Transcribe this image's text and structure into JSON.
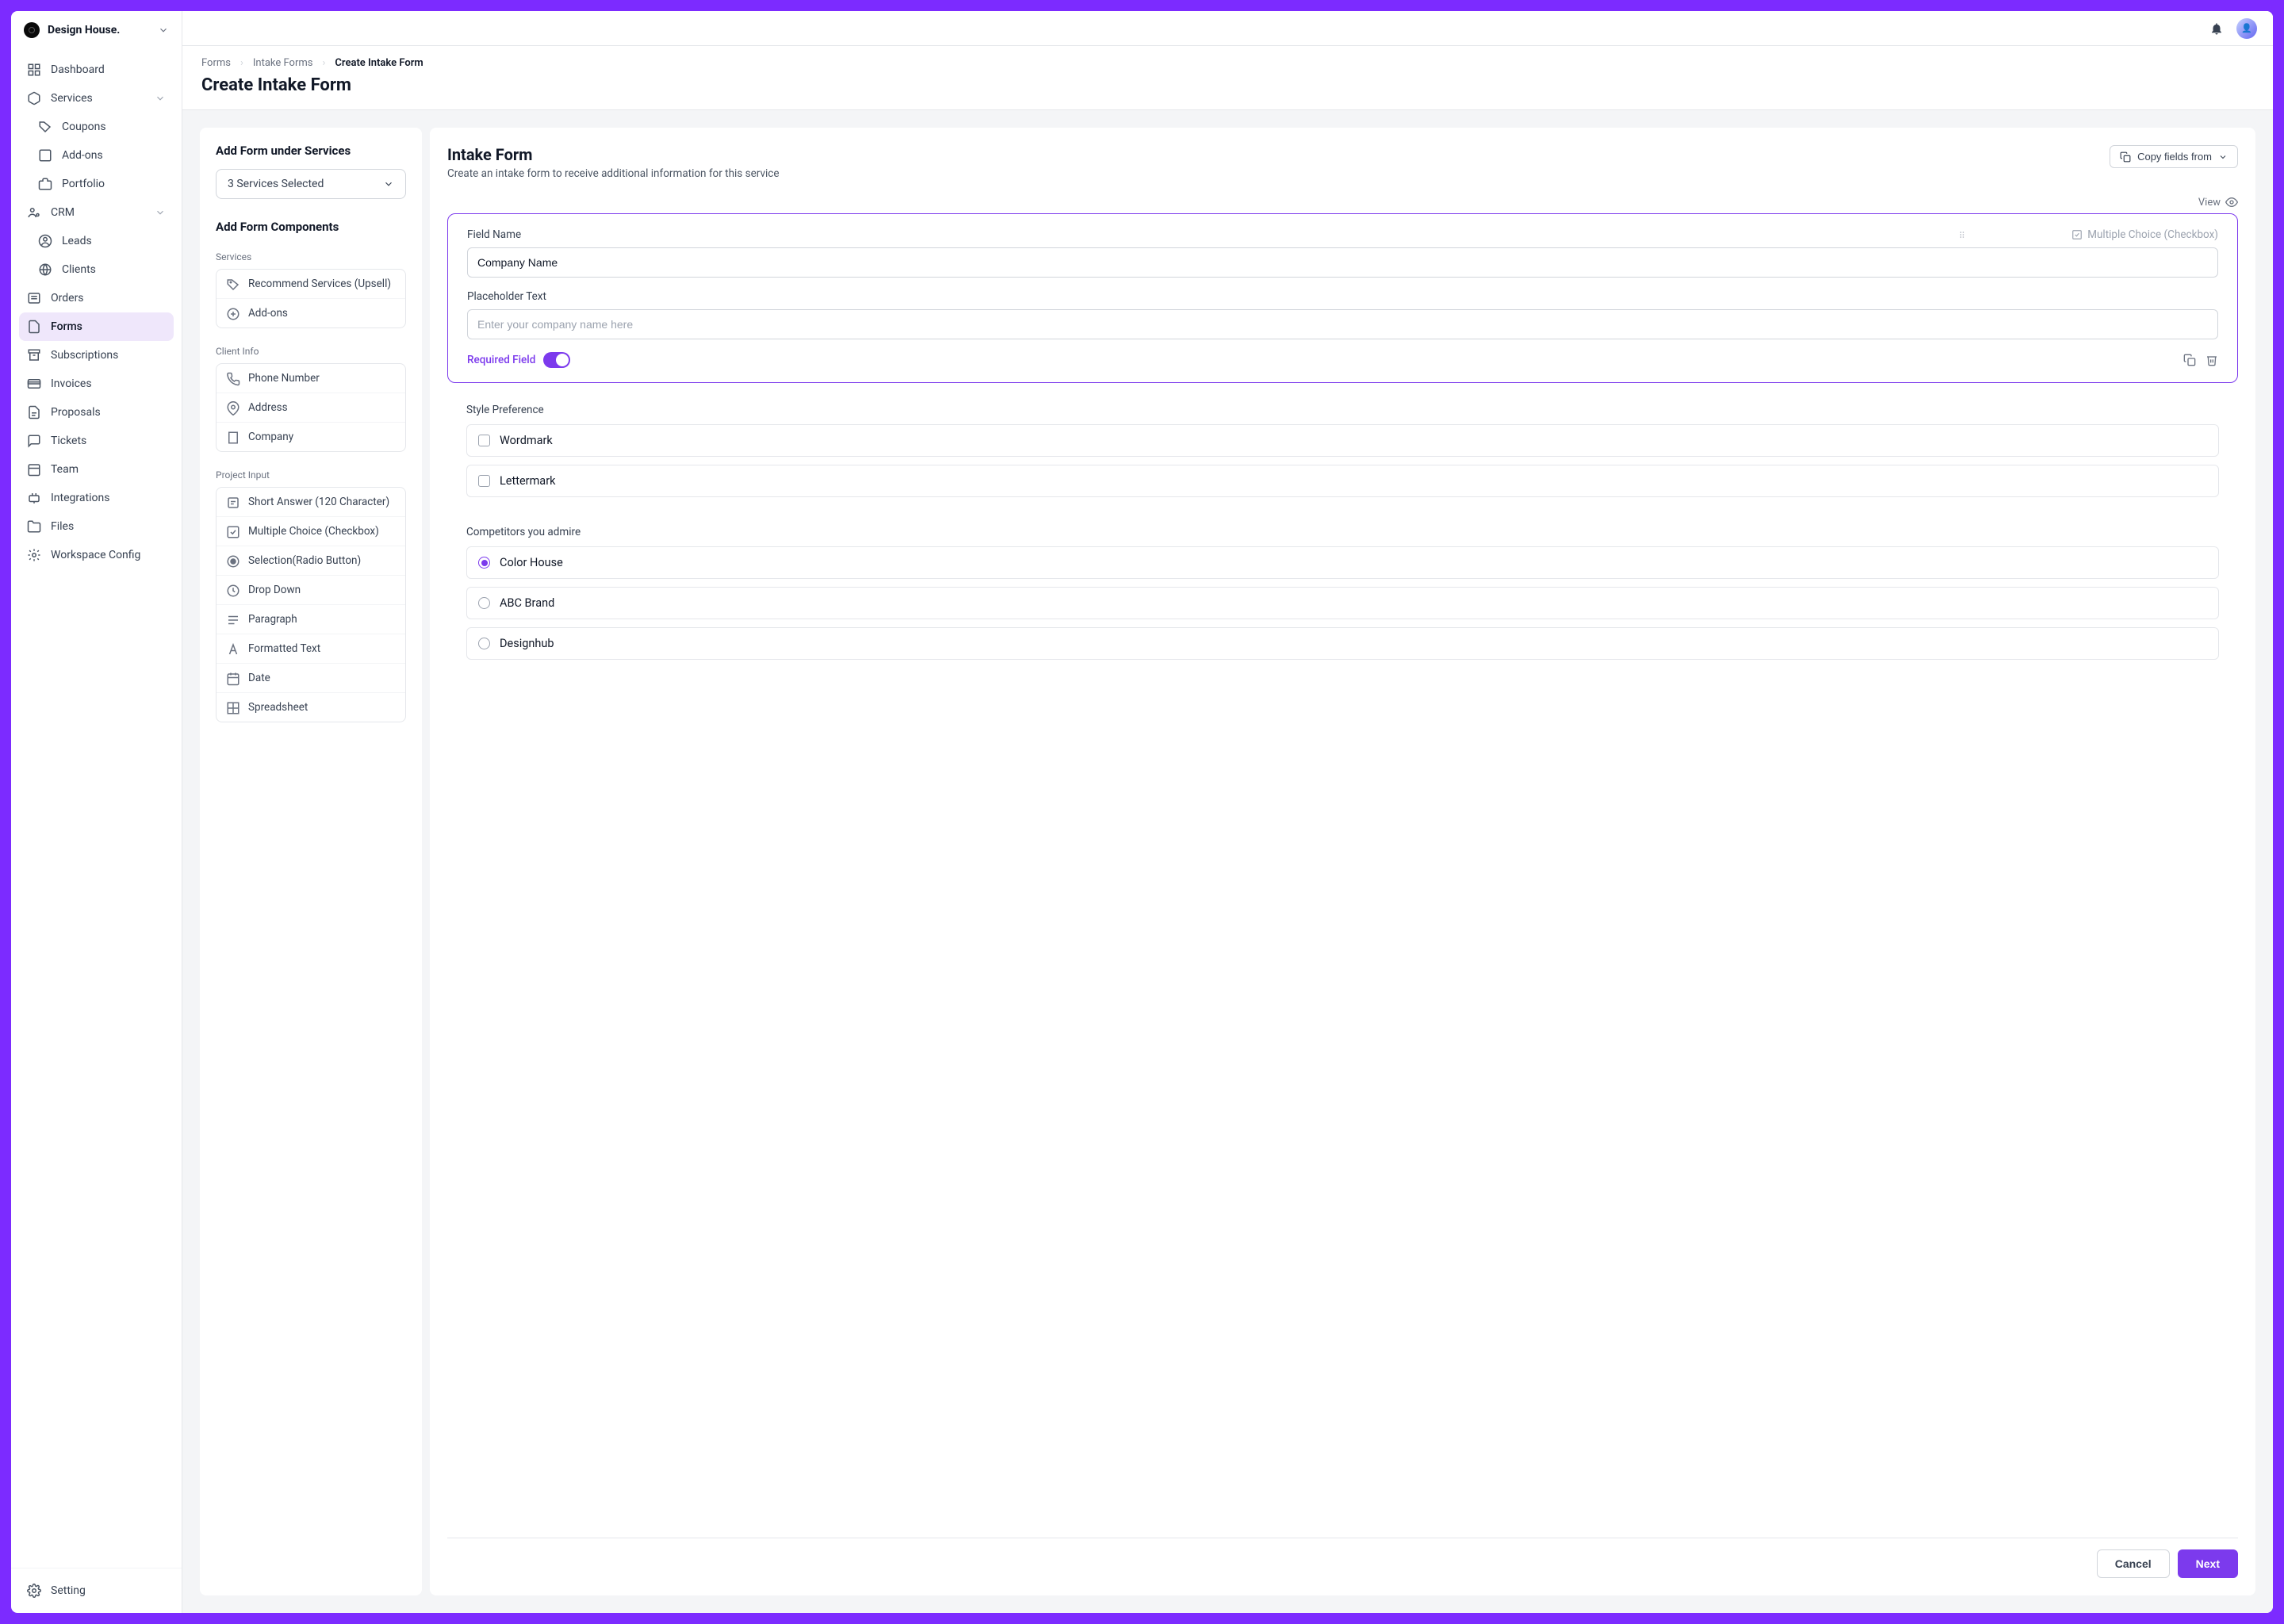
{
  "workspace": {
    "name": "Design House."
  },
  "sidebar": {
    "items": [
      {
        "label": "Dashboard",
        "icon": "dashboard-icon"
      },
      {
        "label": "Services",
        "icon": "box-icon",
        "expandable": true
      },
      {
        "label": "Coupons",
        "icon": "tag-icon",
        "sub": true
      },
      {
        "label": "Add-ons",
        "icon": "plus-square-icon",
        "sub": true
      },
      {
        "label": "Portfolio",
        "icon": "briefcase-icon",
        "sub": true
      },
      {
        "label": "CRM",
        "icon": "people-gear-icon",
        "expandable": true
      },
      {
        "label": "Leads",
        "icon": "person-circle-icon",
        "sub": true
      },
      {
        "label": "Clients",
        "icon": "globe-icon",
        "sub": true
      },
      {
        "label": "Orders",
        "icon": "list-icon"
      },
      {
        "label": "Forms",
        "icon": "file-icon",
        "active": true
      },
      {
        "label": "Subscriptions",
        "icon": "archive-icon"
      },
      {
        "label": "Invoices",
        "icon": "card-icon"
      },
      {
        "label": "Proposals",
        "icon": "document-icon"
      },
      {
        "label": "Tickets",
        "icon": "chat-icon"
      },
      {
        "label": "Team",
        "icon": "calendar-icon"
      },
      {
        "label": "Integrations",
        "icon": "plug-icon"
      },
      {
        "label": "Files",
        "icon": "folder-icon"
      },
      {
        "label": "Workspace Config",
        "icon": "gear-icon"
      }
    ],
    "footer": {
      "label": "Setting",
      "icon": "gear-icon"
    }
  },
  "breadcrumbs": [
    "Forms",
    "Intake Forms",
    "Create Intake Form"
  ],
  "page_title": "Create Intake Form",
  "left_panel": {
    "add_under_title": "Add Form under Services",
    "services_selected": "3 Services Selected",
    "add_components_title": "Add Form Components",
    "groups": [
      {
        "label": "Services",
        "items": [
          {
            "label": "Recommend Services (Upsell)",
            "icon": "tag-outline-icon"
          },
          {
            "label": "Add-ons",
            "icon": "circle-plus-icon"
          }
        ]
      },
      {
        "label": "Client Info",
        "items": [
          {
            "label": "Phone Number",
            "icon": "phone-icon"
          },
          {
            "label": "Address",
            "icon": "pin-icon"
          },
          {
            "label": "Company",
            "icon": "building-icon"
          }
        ]
      },
      {
        "label": "Project Input",
        "items": [
          {
            "label": "Short Answer (120 Character)",
            "icon": "text-line-icon"
          },
          {
            "label": "Multiple Choice (Checkbox)",
            "icon": "checkbox-icon"
          },
          {
            "label": "Selection(Radio Button)",
            "icon": "radio-icon"
          },
          {
            "label": "Drop Down",
            "icon": "clock-icon"
          },
          {
            "label": "Paragraph",
            "icon": "paragraph-icon"
          },
          {
            "label": "Formatted Text",
            "icon": "format-icon"
          },
          {
            "label": "Date",
            "icon": "date-icon"
          },
          {
            "label": "Spreadsheet",
            "icon": "grid-icon"
          }
        ]
      }
    ]
  },
  "right_panel": {
    "title": "Intake Form",
    "subtitle": "Create an intake form to receive additional information for this service",
    "copy_button": "Copy fields from",
    "view_label": "View",
    "field_card": {
      "field_name_label": "Field Name",
      "field_name_value": "Company Name",
      "type_label": "Multiple Choice (Checkbox)",
      "placeholder_label": "Placeholder Text",
      "placeholder_hint": "Enter your company name here",
      "required_label": "Required Field"
    },
    "style_pref": {
      "label": "Style Preference",
      "options": [
        "Wordmark",
        "Lettermark"
      ]
    },
    "competitors": {
      "label": "Competitors you admire",
      "options": [
        "Color House",
        "ABC Brand",
        "Designhub"
      ],
      "selected": 0
    }
  },
  "footer": {
    "cancel": "Cancel",
    "next": "Next"
  }
}
